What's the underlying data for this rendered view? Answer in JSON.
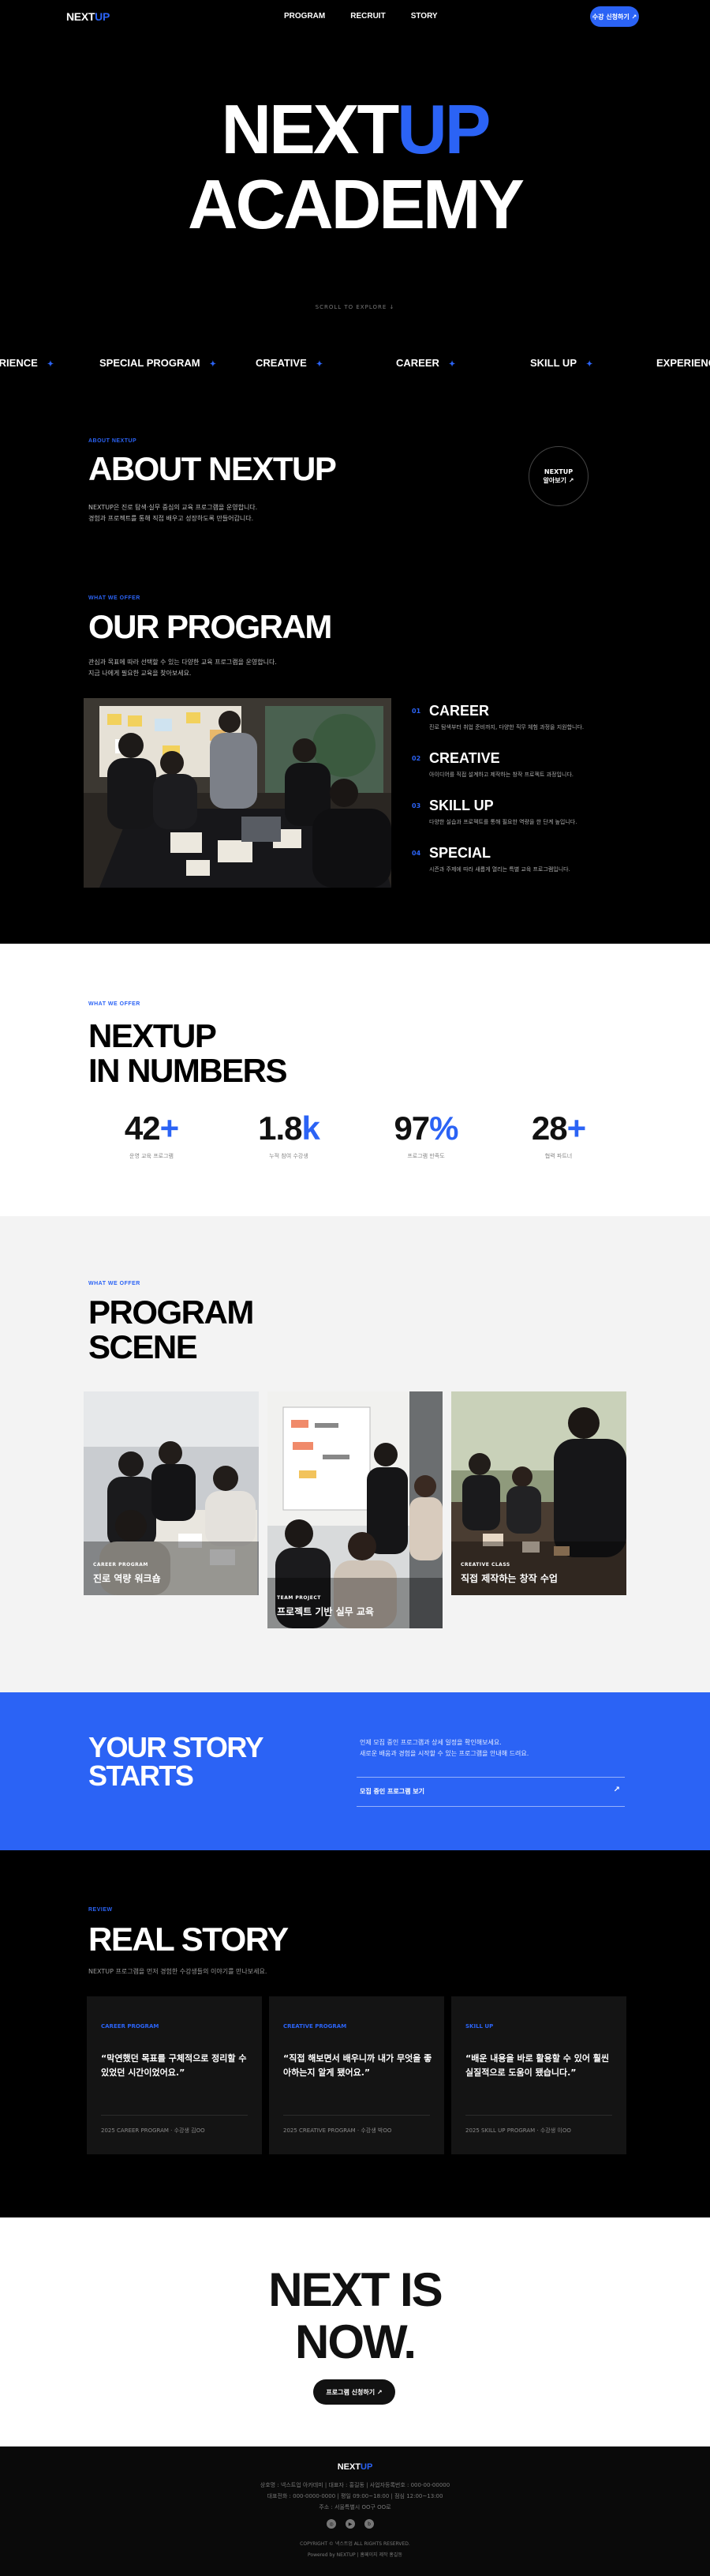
{
  "header": {
    "logo_next": "NEXT",
    "logo_up": "UP",
    "nav": [
      "PROGRAM",
      "RECRUIT",
      "STORY"
    ],
    "apply_label": "수강 신청하기 ↗"
  },
  "hero": {
    "line1_a": "NEXT",
    "line1_b": "UP",
    "line2": "ACADEMY",
    "scroll_hint": "SCROLL TO EXPLORE ↓"
  },
  "marquee": [
    "ERIENCE",
    "SPECIAL PROGRAM",
    "CREATIVE",
    "CAREER",
    "SKILL UP",
    "EXPERIENC"
  ],
  "about": {
    "eyebrow": "ABOUT NEXTUP",
    "title": "ABOUT NEXTUP",
    "body1": "NEXTUP은 진로 탐색·실무 중심의 교육 프로그램을 운영합니다.",
    "body2": "경험과 프로젝트를 통해 직접 배우고 성장하도록 만들어갑니다.",
    "circle_line1": "NEXTUP",
    "circle_line2": "알아보기 ↗"
  },
  "program": {
    "eyebrow": "WHAT WE OFFER",
    "title": "OUR PROGRAM",
    "body1": "관심과 목표에 따라 선택할 수 있는 다양한 교육 프로그램을 운영합니다.",
    "body2": "지금 나에게 필요한 교육을 찾아보세요.",
    "items": [
      {
        "num": "01",
        "name": "CAREER",
        "desc": "진로 탐색부터 취업 준비까지, 다양한 직무 체험 과정을 지원합니다."
      },
      {
        "num": "02",
        "name": "CREATIVE",
        "desc": "아이디어를 직접 설계하고 제작하는 창작 프로젝트 과정입니다."
      },
      {
        "num": "03",
        "name": "SKILL UP",
        "desc": "다양한 실습과 프로젝트를 통해 필요한 역량을 한 단계 높입니다."
      },
      {
        "num": "04",
        "name": "SPECIAL",
        "desc": "시즌과 주제에 따라 새롭게 열리는 특별 교육 프로그램입니다."
      }
    ]
  },
  "numbers": {
    "eyebrow": "WHAT WE OFFER",
    "title_line1": "NEXTUP",
    "title_line2": "IN NUMBERS",
    "stats": [
      {
        "value": "42",
        "suffix": "+",
        "label": "운영 교육 프로그램"
      },
      {
        "value": "1.8",
        "suffix": "k",
        "label": "누적 참여 수강생"
      },
      {
        "value": "97",
        "suffix": "%",
        "label": "프로그램 만족도"
      },
      {
        "value": "28",
        "suffix": "+",
        "label": "협력 파트너"
      }
    ]
  },
  "scene": {
    "eyebrow": "WHAT WE OFFER",
    "title_line1": "PROGRAM",
    "title_line2": "SCENE",
    "cards": [
      {
        "tag": "CAREER PROGRAM",
        "caption": "진로 역량 워크숍"
      },
      {
        "tag": "TEAM PROJECT",
        "caption": "프로젝트 기반 실무 교육"
      },
      {
        "tag": "CREATIVE CLASS",
        "caption": "직접 제작하는 창작 수업"
      }
    ]
  },
  "story_starts": {
    "title_line1": "YOUR STORY",
    "title_line2": "STARTS",
    "body1": "언제 모집 중인 프로그램과 상세 일정을 확인해보세요.",
    "body2": "새로운 배움과 경험을 시작할 수 있는 프로그램을 안내해 드려요.",
    "link_label": "모집 중인 프로그램 보기",
    "link_arrow": "↗"
  },
  "review": {
    "eyebrow": "REVIEW",
    "title": "REAL STORY",
    "subtitle": "NEXTUP 프로그램을 먼저 경험한 수강생들의 이야기를 만나보세요.",
    "cards": [
      {
        "category": "CAREER PROGRAM",
        "quote": "“막연했던 목표를 구체적으로 정리할 수 있었던 시간이었어요.”",
        "author": "2025 CAREER PROGRAM · 수강생 김OO"
      },
      {
        "category": "CREATIVE PROGRAM",
        "quote": "“직접 해보면서 배우니까 내가 무엇을 좋아하는지 알게 됐어요.”",
        "author": "2025 CREATIVE PROGRAM · 수강생 박OO"
      },
      {
        "category": "SKILL UP",
        "quote": "“배운 내용을 바로 활용할 수 있어 훨씬 실질적으로 도움이 됐습니다.”",
        "author": "2025 SKILL UP PROGRAM · 수강생 이OO"
      }
    ]
  },
  "cta": {
    "line1": "NEXT IS",
    "line2": "NOW.",
    "button": "프로그램 신청하기 ↗"
  },
  "footer": {
    "logo_next": "NEXT",
    "logo_up": "UP",
    "info1": "상호명 : 넥스트업 아카데미 | 대표자 : 홍길동 | 사업자등록번호 : 000-00-00000",
    "info2": "대표전화 : 000-0000-0000 | 평일 09:00~18:00 | 점심 12:00~13:00",
    "info3": "주소 : 서울특별시 OO구 OO로",
    "copyright": "COPYRIGHT © 넥스트업 ALL RIGHTS RESERVED.",
    "powered": "Powered by NEXTUP | 홈페이지 제작 홍길동",
    "sns": [
      "instagram-icon",
      "youtube-icon",
      "blog-icon"
    ]
  }
}
